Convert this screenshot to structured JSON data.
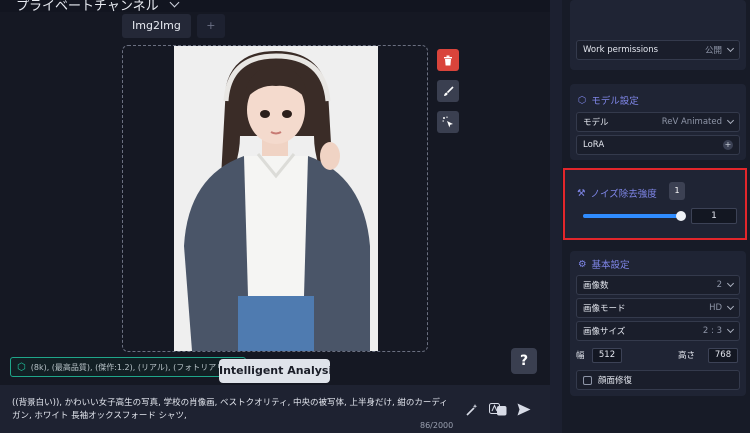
{
  "header": {
    "channel": "プライベートチャンネル"
  },
  "tabs": [
    {
      "label": "Img2Img"
    },
    {
      "label": "+"
    }
  ],
  "canvas": {
    "image_alt": "girl photo"
  },
  "tools": {
    "delete": "delete",
    "brush": "brush",
    "magic": "magic"
  },
  "help": {
    "label": "?"
  },
  "analysis": {
    "label": "Intelligent Analysis"
  },
  "tag_chip": {
    "text": "(8k), (最高品質), (傑作:1.2), (リアル), (フォトリアリス..."
  },
  "prompt": {
    "text": "((背景白い)), かわいい女子高生の写真, 学校の肖像画, ベストクオリティ, 中央の被写体, 上半身だけ, 紺のカーディガン, ホワイト 長袖オックスフォード シャツ,",
    "counter": "86/2000"
  },
  "right_panel": {
    "work_permissions": {
      "label": "Work permissions",
      "value": "公開"
    },
    "model_section": {
      "title": "モデル設定",
      "model_label": "モデル",
      "model_value": "ReV Animated",
      "lora_label": "LoRA"
    },
    "noise": {
      "title": "ノイズ除去強度",
      "value": "1",
      "tooltip": "1",
      "slider_level": 1.0
    },
    "basic_section": {
      "title": "基本設定",
      "image_count": {
        "label": "画像数",
        "value": "2"
      },
      "image_mode": {
        "label": "画像モード",
        "value": "HD"
      },
      "image_size": {
        "label": "画像サイズ",
        "value": "2 : 3"
      },
      "width": {
        "label": "幅",
        "value": "512"
      },
      "height": {
        "label": "高さ",
        "value": "768"
      },
      "face_fix": {
        "label": "顔面修復"
      }
    }
  },
  "colors": {
    "accent": "#2f8cff",
    "highlight_border": "#e2262b",
    "delete": "#d9443b",
    "section_title": "#7f86e8"
  }
}
